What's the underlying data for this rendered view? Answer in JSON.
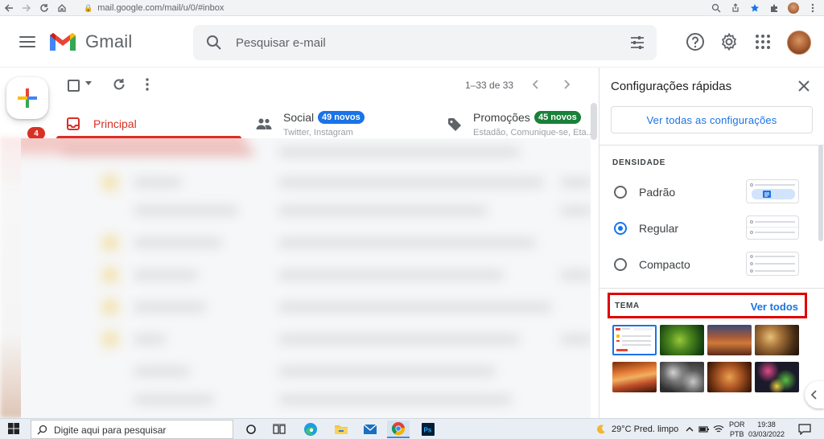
{
  "browser": {
    "url": "mail.google.com/mail/u/0/#inbox"
  },
  "header": {
    "logo_text": "Gmail",
    "search_placeholder": "Pesquisar e-mail"
  },
  "rail": {
    "badge": "4"
  },
  "toolbar": {
    "pagination": "1–33 de 33"
  },
  "tabs": [
    {
      "label": "Principal",
      "color": "#d93025"
    },
    {
      "label": "Social",
      "badge": "49 novos",
      "sub": "Twitter, Instagram",
      "badge_color": "#1a73e8"
    },
    {
      "label": "Promoções",
      "badge": "45 novos",
      "sub": "Estadão, Comunique-se, Eta...",
      "badge_color": "#188038"
    }
  ],
  "quick_settings": {
    "title": "Configurações rápidas",
    "all_settings": "Ver todas as configurações",
    "density_title": "DENSIDADE",
    "density_options": [
      {
        "label": "Padrão",
        "selected": false
      },
      {
        "label": "Regular",
        "selected": true
      },
      {
        "label": "Compacto",
        "selected": false
      }
    ],
    "theme_title": "TEMA",
    "theme_link": "Ver todos"
  },
  "taskbar": {
    "search_placeholder": "Digite aqui para pesquisar",
    "weather": "29°C  Pred. limpo",
    "lang_top": "POR",
    "lang_bottom": "PTB",
    "time": "19:38",
    "date": "03/03/2022"
  }
}
